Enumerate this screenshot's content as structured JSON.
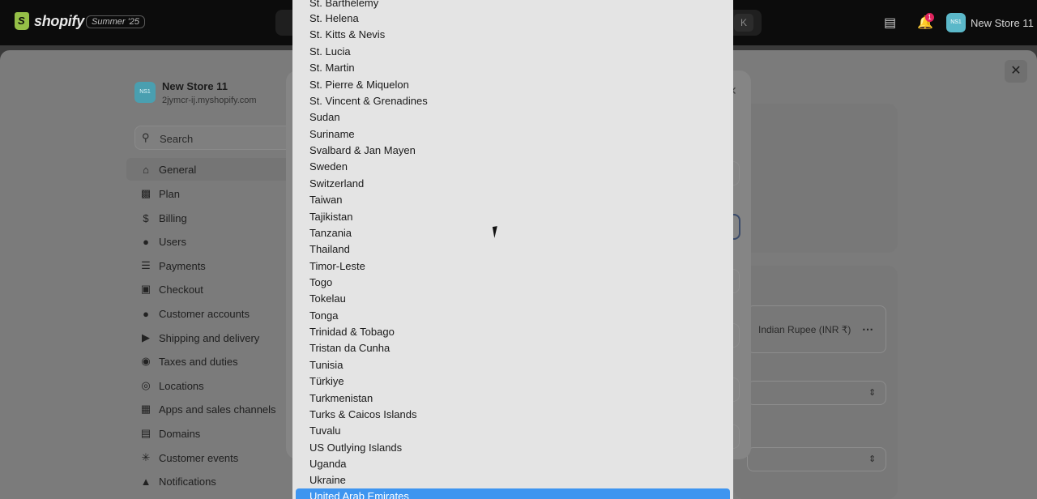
{
  "topbar": {
    "brand": "shopify",
    "edition": "Summer '25",
    "shortcut_key": "K",
    "notification_count": "1",
    "avatar_initials": "NS1",
    "store_name": "New Store 11"
  },
  "sidebar": {
    "store_avatar": "NS1",
    "store_name": "New Store 11",
    "store_domain": "2jymcr-ij.myshopify.com",
    "search_placeholder": "Search",
    "items": [
      {
        "label": "General",
        "icon": "store-icon"
      },
      {
        "label": "Plan",
        "icon": "plan-icon"
      },
      {
        "label": "Billing",
        "icon": "billing-icon"
      },
      {
        "label": "Users",
        "icon": "users-icon"
      },
      {
        "label": "Payments",
        "icon": "payments-icon"
      },
      {
        "label": "Checkout",
        "icon": "cart-icon"
      },
      {
        "label": "Customer accounts",
        "icon": "person-icon"
      },
      {
        "label": "Shipping and delivery",
        "icon": "truck-icon"
      },
      {
        "label": "Taxes and duties",
        "icon": "taxes-icon"
      },
      {
        "label": "Locations",
        "icon": "location-pin-icon"
      },
      {
        "label": "Apps and sales channels",
        "icon": "apps-icon"
      },
      {
        "label": "Domains",
        "icon": "globe-icon"
      },
      {
        "label": "Customer events",
        "icon": "sparkle-icon"
      },
      {
        "label": "Notifications",
        "icon": "bell-icon"
      }
    ]
  },
  "main": {
    "currency_label": "Indian Rupee (INR ₹)"
  },
  "dropdown": {
    "options": [
      "St. Barthélemy",
      "St. Helena",
      "St. Kitts & Nevis",
      "St. Lucia",
      "St. Martin",
      "St. Pierre & Miquelon",
      "St. Vincent & Grenadines",
      "Sudan",
      "Suriname",
      "Svalbard & Jan Mayen",
      "Sweden",
      "Switzerland",
      "Taiwan",
      "Tajikistan",
      "Tanzania",
      "Thailand",
      "Timor-Leste",
      "Togo",
      "Tokelau",
      "Tonga",
      "Trinidad & Tobago",
      "Tristan da Cunha",
      "Tunisia",
      "Türkiye",
      "Turkmenistan",
      "Turks & Caicos Islands",
      "Tuvalu",
      "US Outlying Islands",
      "Uganda",
      "Ukraine",
      "United Arab Emirates"
    ],
    "selected": "United Arab Emirates"
  }
}
